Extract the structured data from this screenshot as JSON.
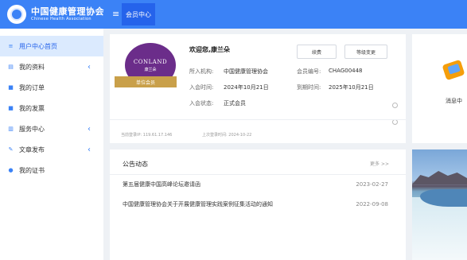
{
  "header": {
    "brand_cn": "中国健康管理协会",
    "brand_en": "Chinese Health Association",
    "menu_icon": "hamburger-icon",
    "active_tab": "会员中心"
  },
  "sidebar": {
    "items": [
      {
        "label": "用户中心首页",
        "icon": "menu-icon",
        "active": true
      },
      {
        "label": "我的资料",
        "icon": "profile-icon",
        "has_submenu": true
      },
      {
        "label": "我的订单",
        "icon": "order-icon"
      },
      {
        "label": "我的发票",
        "icon": "invoice-icon"
      },
      {
        "label": "服务中心",
        "icon": "service-icon",
        "has_submenu": true
      },
      {
        "label": "文章发布",
        "icon": "pen-icon",
        "has_submenu": true
      },
      {
        "label": "我的证书",
        "icon": "drop-icon"
      }
    ]
  },
  "profile": {
    "avatar_name": "CONLAND",
    "avatar_sub": "康兰朵",
    "badge": "单位会员",
    "welcome": "欢迎您,康兰朵",
    "renew_button": "续费",
    "change_button": "等级变更",
    "org_label": "所入机构:",
    "org_value": "中国健康管理协会",
    "member_no_label": "会员编号:",
    "member_no_value": "CHAG00448",
    "join_label": "入会时间:",
    "join_value": "2024年10月21日",
    "expire_label": "到期时间:",
    "expire_value": "2025年10月21日",
    "status_label": "入会状态:",
    "status_value": "正式会员",
    "login_ip": "当前登录IP: 119.61.17.146",
    "last_login": "上次登录时间: 2024-10-22"
  },
  "messages": {
    "label": "消息中"
  },
  "notices": {
    "title": "公告动态",
    "more": "更多 >>",
    "items": [
      {
        "title": "第五届健康中国高峰论坛邀请函",
        "date": "2023-02-27"
      },
      {
        "title": "中国健康管理协会关于开展健康管理实践案例征集活动的通知",
        "date": "2022-09-08"
      }
    ]
  }
}
